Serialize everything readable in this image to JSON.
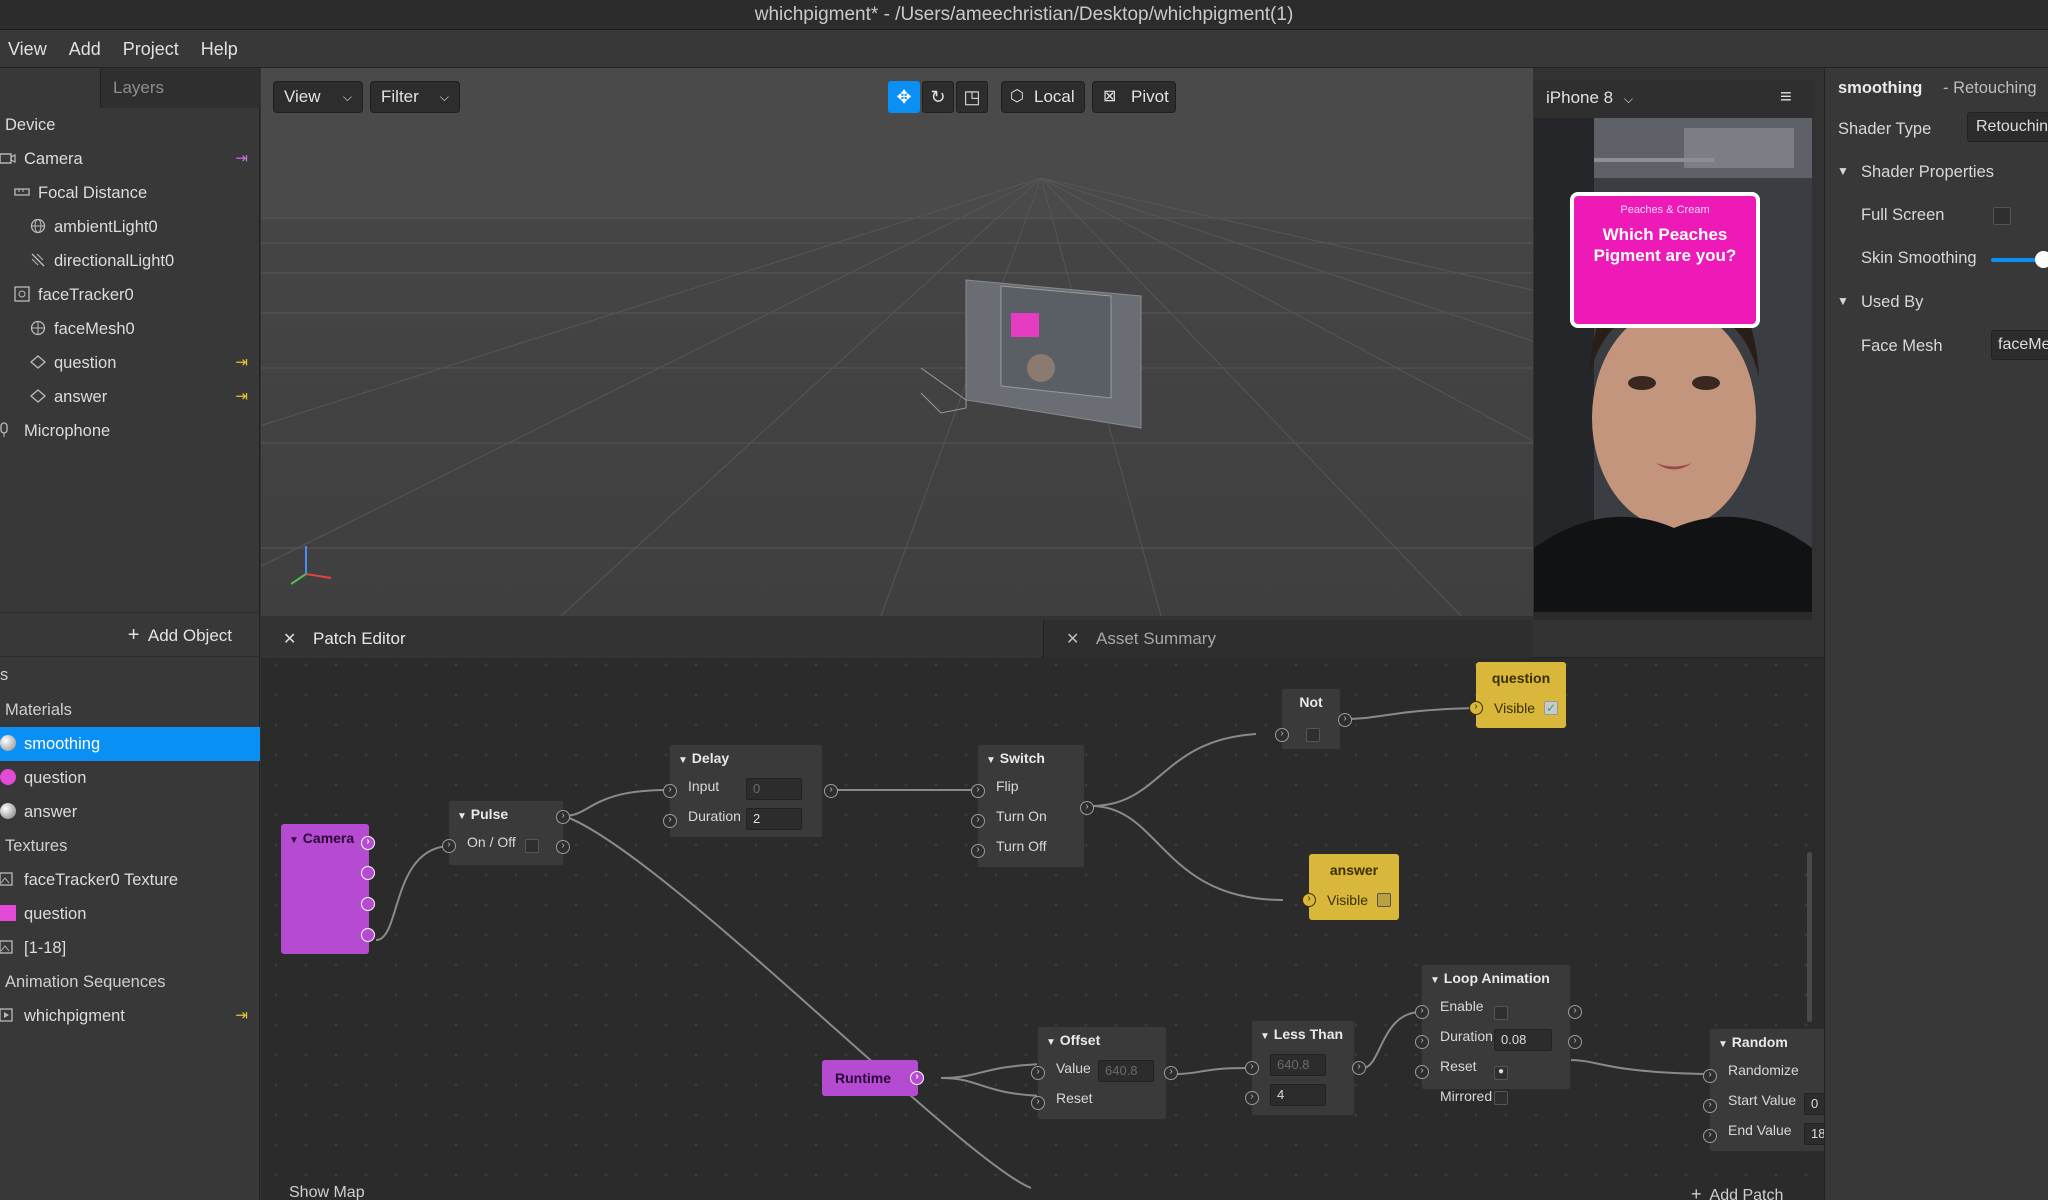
{
  "window": {
    "title": "whichpigment* - /Users/ameechristian/Desktop/whichpigment(1)"
  },
  "menu": [
    "View",
    "Add",
    "Project",
    "Help"
  ],
  "layers": {
    "tab": "Layers",
    "items": [
      "Device",
      "Camera",
      "Focal Distance",
      "ambientLight0",
      "directionalLight0",
      "faceTracker0",
      "faceMesh0",
      "question",
      "answer",
      "Microphone"
    ],
    "add_object": "Add Object"
  },
  "assets": {
    "header": "s",
    "sections": [
      "Materials",
      "Textures",
      "Animation Sequences"
    ],
    "materials": [
      "smoothing",
      "question",
      "answer"
    ],
    "textures": [
      "faceTracker0 Texture",
      "question",
      "[1-18]"
    ],
    "sequences": [
      "whichpigment"
    ]
  },
  "viewport": {
    "view_label": "View",
    "filter_label": "Filter",
    "local_label": "Local",
    "pivot_label": "Pivot"
  },
  "simulator": {
    "device": "iPhone 8",
    "card_brand": "Peaches & Cream",
    "card_text": "Which Peaches Pigment are you?"
  },
  "inspector": {
    "name": "smoothing",
    "subtitle": "- Retouching",
    "shader_type_label": "Shader Type",
    "shader_type_value": "Retouchin",
    "shader_props": "Shader Properties",
    "full_screen": "Full Screen",
    "skin_smoothing": "Skin Smoothing",
    "skin_smoothing_level": 0.85,
    "used_by": "Used By",
    "face_mesh_label": "Face Mesh",
    "face_mesh_value": "faceMe"
  },
  "patch_editor": {
    "tab_patch": "Patch Editor",
    "tab_assets": "Asset Summary",
    "show_map": "Show Map",
    "add_patch": "Add Patch",
    "nodes": {
      "camera": "Camera",
      "pulse": {
        "title": "Pulse",
        "onoff": "On / Off"
      },
      "delay": {
        "title": "Delay",
        "input": "Input",
        "input_val": "0",
        "duration": "Duration",
        "duration_val": "2"
      },
      "switch": {
        "title": "Switch",
        "flip": "Flip",
        "turn_on": "Turn On",
        "turn_off": "Turn Off"
      },
      "not": "Not",
      "question": {
        "title": "question",
        "visible": "Visible"
      },
      "answer": {
        "title": "answer",
        "visible": "Visible"
      },
      "runtime": "Runtime",
      "offset": {
        "title": "Offset",
        "value": "Value",
        "value_val": "640.8",
        "reset": "Reset"
      },
      "less_than": {
        "title": "Less Than",
        "a": "640.8",
        "b": "4"
      },
      "loop": {
        "title": "Loop Animation",
        "enable": "Enable",
        "duration": "Duration",
        "duration_val": "0.08",
        "reset": "Reset",
        "mirrored": "Mirrored"
      },
      "random": {
        "title": "Random",
        "randomize": "Randomize",
        "start": "Start Value",
        "start_val": "0",
        "end": "End Value",
        "end_val": "18"
      }
    }
  },
  "colors": {
    "accent": "#0a8ff5",
    "patch_yellow": "#d9b73a",
    "patch_purple": "#b44bd1",
    "card_pink": "#ee1ab8"
  }
}
